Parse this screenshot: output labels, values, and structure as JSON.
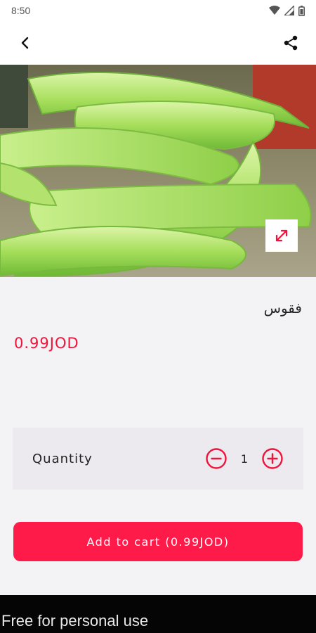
{
  "status": {
    "time": "8:50"
  },
  "icons": {
    "back": "back-arrow-icon",
    "share": "share-icon",
    "expand": "expand-icon",
    "minus": "minus-circle-icon",
    "plus": "plus-circle-icon"
  },
  "product": {
    "name": "فقوس",
    "price": "0.99JOD"
  },
  "quantity": {
    "label": "Quantity",
    "value": "1"
  },
  "cart": {
    "button_label": "Add to cart (0.99JOD)"
  },
  "watermark": {
    "text": "Free for personal use"
  },
  "colors": {
    "accent": "#fe1a49",
    "price": "#f0133b"
  }
}
